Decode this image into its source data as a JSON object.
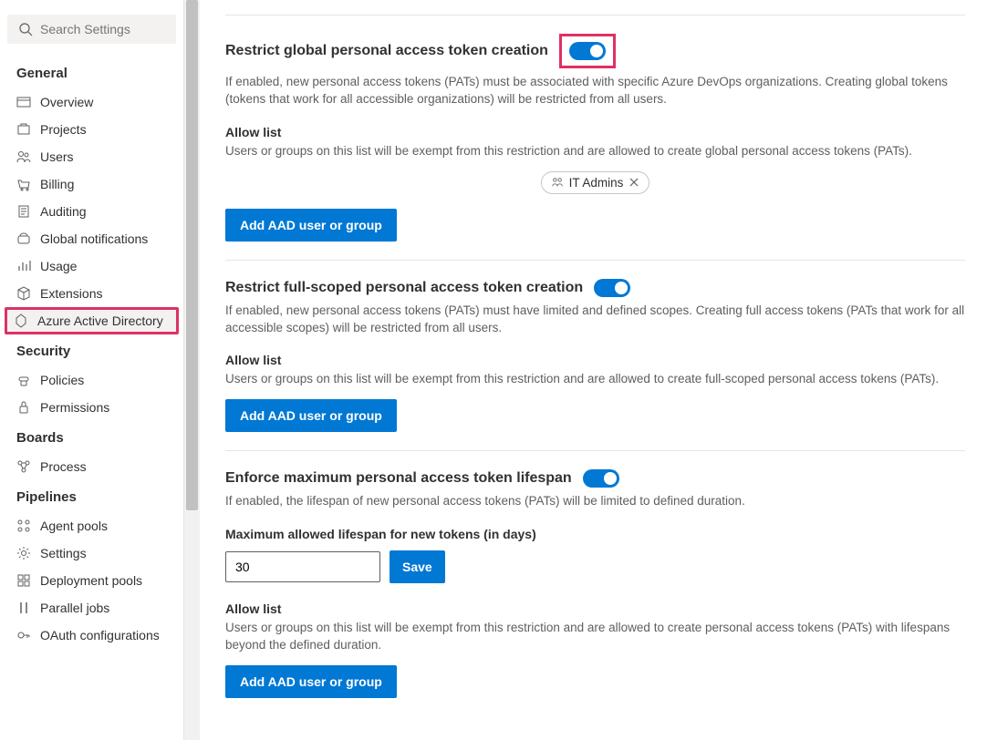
{
  "search": {
    "placeholder": "Search Settings"
  },
  "nav": {
    "general": {
      "title": "General",
      "items": [
        {
          "label": "Overview"
        },
        {
          "label": "Projects"
        },
        {
          "label": "Users"
        },
        {
          "label": "Billing"
        },
        {
          "label": "Auditing"
        },
        {
          "label": "Global notifications"
        },
        {
          "label": "Usage"
        },
        {
          "label": "Extensions"
        },
        {
          "label": "Azure Active Directory"
        }
      ]
    },
    "security": {
      "title": "Security",
      "items": [
        {
          "label": "Policies"
        },
        {
          "label": "Permissions"
        }
      ]
    },
    "boards": {
      "title": "Boards",
      "items": [
        {
          "label": "Process"
        }
      ]
    },
    "pipelines": {
      "title": "Pipelines",
      "items": [
        {
          "label": "Agent pools"
        },
        {
          "label": "Settings"
        },
        {
          "label": "Deployment pools"
        },
        {
          "label": "Parallel jobs"
        },
        {
          "label": "OAuth configurations"
        }
      ]
    }
  },
  "section1": {
    "title": "Restrict global personal access token creation",
    "desc": "If enabled, new personal access tokens (PATs) must be associated with specific Azure DevOps organizations. Creating global tokens (tokens that work for all accessible organizations) will be restricted from all users.",
    "allow_title": "Allow list",
    "allow_desc": "Users or groups on this list will be exempt from this restriction and are allowed to create global personal access tokens (PATs).",
    "chip": "IT Admins",
    "button": "Add AAD user or group"
  },
  "section2": {
    "title": "Restrict full-scoped personal access token creation",
    "desc": "If enabled, new personal access tokens (PATs) must have limited and defined scopes. Creating full access tokens (PATs that work for all accessible scopes) will be restricted from all users.",
    "allow_title": "Allow list",
    "allow_desc": "Users or groups on this list will be exempt from this restriction and are allowed to create full-scoped personal access tokens (PATs).",
    "button": "Add AAD user or group"
  },
  "section3": {
    "title": "Enforce maximum personal access token lifespan",
    "desc": "If enabled, the lifespan of new personal access tokens (PATs) will be limited to defined duration.",
    "max_label": "Maximum allowed lifespan for new tokens (in days)",
    "max_value": "30",
    "save": "Save",
    "allow_title": "Allow list",
    "allow_desc": "Users or groups on this list will be exempt from this restriction and are allowed to create personal access tokens (PATs) with lifespans beyond the defined duration.",
    "button": "Add AAD user or group"
  }
}
